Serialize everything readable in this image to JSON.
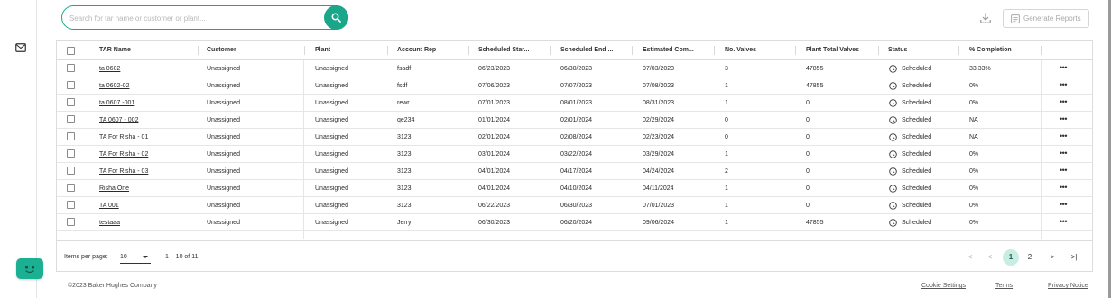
{
  "search": {
    "placeholder": "Search for tar name or customer or plant..."
  },
  "toolbar": {
    "download_icon": "download-icon",
    "generate_reports_label": "Generate Reports",
    "generate_reports_icon": "document-icon"
  },
  "table": {
    "columns": [
      "TAR Name",
      "Customer",
      "Plant",
      "Account Rep",
      "Scheduled Star...",
      "Scheduled End ...",
      "Estimated Com...",
      "No. Valves",
      "Plant Total Valves",
      "Status",
      "% Completion"
    ],
    "rows": [
      {
        "tar_name": "ta 0602",
        "customer": "Unassigned",
        "plant": "Unassigned",
        "account_rep": "fsadf",
        "scheduled_start": "06/23/2023",
        "scheduled_end": "06/30/2023",
        "estimated_completion": "07/03/2023",
        "no_valves": "3",
        "plant_total_valves": "47855",
        "status": "Scheduled",
        "completion": "33.33%"
      },
      {
        "tar_name": "ta 0602-02",
        "customer": "Unassigned",
        "plant": "Unassigned",
        "account_rep": "fsdf",
        "scheduled_start": "07/06/2023",
        "scheduled_end": "07/07/2023",
        "estimated_completion": "07/08/2023",
        "no_valves": "1",
        "plant_total_valves": "47855",
        "status": "Scheduled",
        "completion": "0%"
      },
      {
        "tar_name": "ta 0607 -001",
        "customer": "Unassigned",
        "plant": "Unassigned",
        "account_rep": "rewr",
        "scheduled_start": "07/01/2023",
        "scheduled_end": "08/01/2023",
        "estimated_completion": "08/31/2023",
        "no_valves": "1",
        "plant_total_valves": "0",
        "status": "Scheduled",
        "completion": "0%"
      },
      {
        "tar_name": "TA 0607 - 002",
        "customer": "Unassigned",
        "plant": "Unassigned",
        "account_rep": "qe234",
        "scheduled_start": "01/01/2024",
        "scheduled_end": "02/01/2024",
        "estimated_completion": "02/29/2024",
        "no_valves": "0",
        "plant_total_valves": "0",
        "status": "Scheduled",
        "completion": "NA"
      },
      {
        "tar_name": "TA For Risha - 01",
        "customer": "Unassigned",
        "plant": "Unassigned",
        "account_rep": "3123",
        "scheduled_start": "02/01/2024",
        "scheduled_end": "02/08/2024",
        "estimated_completion": "02/23/2024",
        "no_valves": "0",
        "plant_total_valves": "0",
        "status": "Scheduled",
        "completion": "NA"
      },
      {
        "tar_name": "TA For Risha - 02",
        "customer": "Unassigned",
        "plant": "Unassigned",
        "account_rep": "3123",
        "scheduled_start": "03/01/2024",
        "scheduled_end": "03/22/2024",
        "estimated_completion": "03/29/2024",
        "no_valves": "1",
        "plant_total_valves": "0",
        "status": "Scheduled",
        "completion": "0%"
      },
      {
        "tar_name": "TA For Risha - 03",
        "customer": "Unassigned",
        "plant": "Unassigned",
        "account_rep": "3123",
        "scheduled_start": "04/01/2024",
        "scheduled_end": "04/17/2024",
        "estimated_completion": "04/24/2024",
        "no_valves": "2",
        "plant_total_valves": "0",
        "status": "Scheduled",
        "completion": "0%"
      },
      {
        "tar_name": "Risha One",
        "customer": "Unassigned",
        "plant": "Unassigned",
        "account_rep": "3123",
        "scheduled_start": "04/01/2024",
        "scheduled_end": "04/10/2024",
        "estimated_completion": "04/11/2024",
        "no_valves": "1",
        "plant_total_valves": "0",
        "status": "Scheduled",
        "completion": "0%"
      },
      {
        "tar_name": "TA 001",
        "customer": "Unassigned",
        "plant": "Unassigned",
        "account_rep": "3123",
        "scheduled_start": "06/22/2023",
        "scheduled_end": "06/30/2023",
        "estimated_completion": "07/01/2023",
        "no_valves": "1",
        "plant_total_valves": "0",
        "status": "Scheduled",
        "completion": "0%"
      },
      {
        "tar_name": "testaaa",
        "customer": "Unassigned",
        "plant": "Unassigned",
        "account_rep": "Jerry",
        "scheduled_start": "06/30/2023",
        "scheduled_end": "06/20/2024",
        "estimated_completion": "09/06/2024",
        "no_valves": "1",
        "plant_total_valves": "47855",
        "status": "Scheduled",
        "completion": "0%"
      }
    ],
    "row_action_label": "•••"
  },
  "pagination": {
    "items_per_page_label": "Items per page:",
    "items_per_page_value": "10",
    "range_text": "1 – 10 of 11",
    "first_label": "|<",
    "prev_label": "<",
    "pages": [
      "1",
      "2"
    ],
    "current_page": "1",
    "next_label": ">",
    "last_label": ">|"
  },
  "footer": {
    "copyright": "©2023 Baker Hughes Company",
    "links": [
      "Cookie Settings",
      "Terms",
      "Privacy Notice"
    ]
  },
  "colors": {
    "accent": "#19a689",
    "page_active_bg": "#c8ede3",
    "chat_fab": "#1bb092"
  },
  "icons": {
    "rail": "mail-icon",
    "status": "clock-icon",
    "chat": "chat-bot-icon"
  }
}
